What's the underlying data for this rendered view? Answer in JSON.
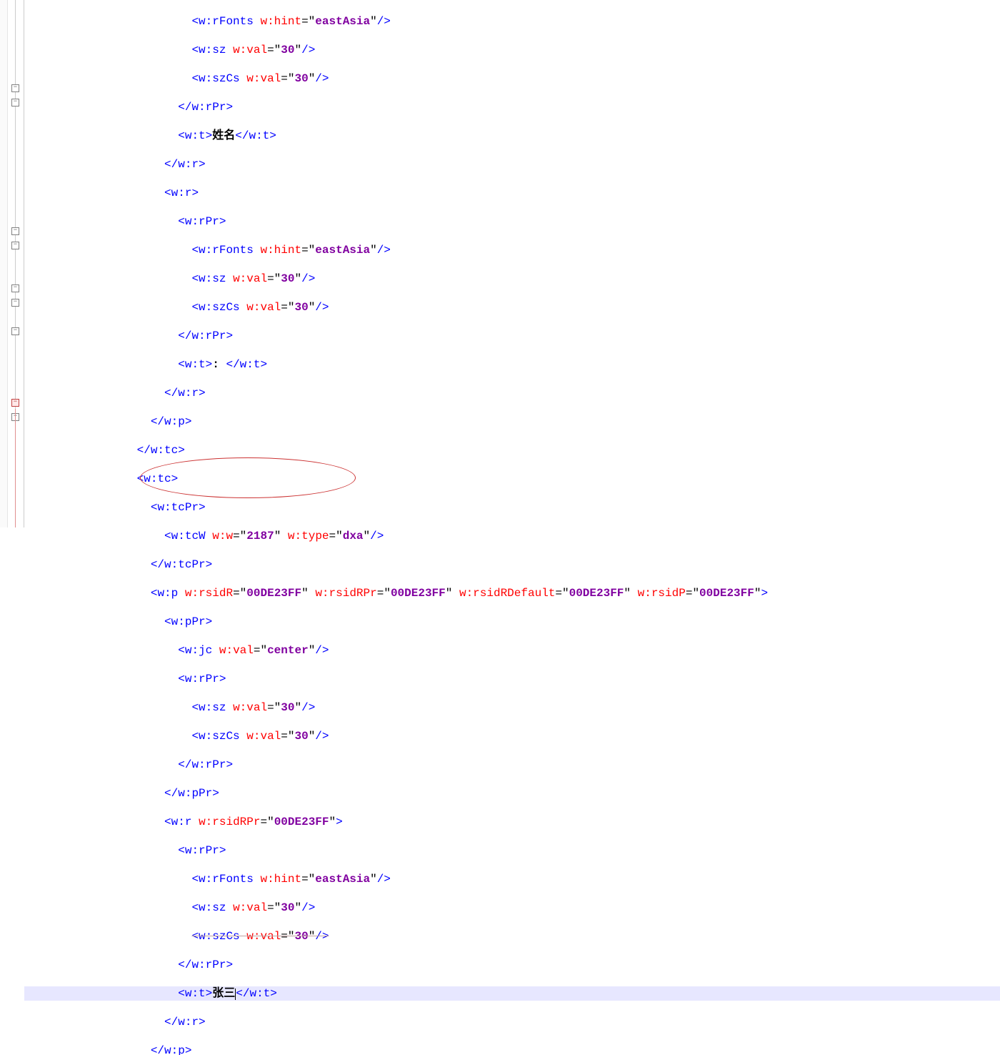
{
  "editor": {
    "rsid": "00DE23FF",
    "values": {
      "val_30": "30",
      "val_2187": "2187",
      "dxa": "dxa",
      "center": "center",
      "eastAsia": "eastAsia"
    },
    "text": {
      "name_label": "姓名",
      "colon_space": ": ",
      "zhang_san": "张三"
    },
    "tags": {
      "w_rFonts": "w:rFonts",
      "w_hint": "w:hint",
      "w_sz": "w:sz",
      "w_szCs": "w:szCs",
      "w_val": "w:val",
      "w_rPr": "w:rPr",
      "w_t": "w:t",
      "w_r": "w:r",
      "w_p": "w:p",
      "w_tc": "w:tc",
      "w_tcPr": "w:tcPr",
      "w_tcW": "w:tcW",
      "w_w": "w:w",
      "w_type": "w:type",
      "w_pPr": "w:pPr",
      "w_jc": "w:jc",
      "w_rsidR": "w:rsidR",
      "w_rsidRPr": "w:rsidRPr",
      "w_rsidRDefault": "w:rsidRDefault",
      "w_rsidP": "w:rsidP"
    }
  }
}
